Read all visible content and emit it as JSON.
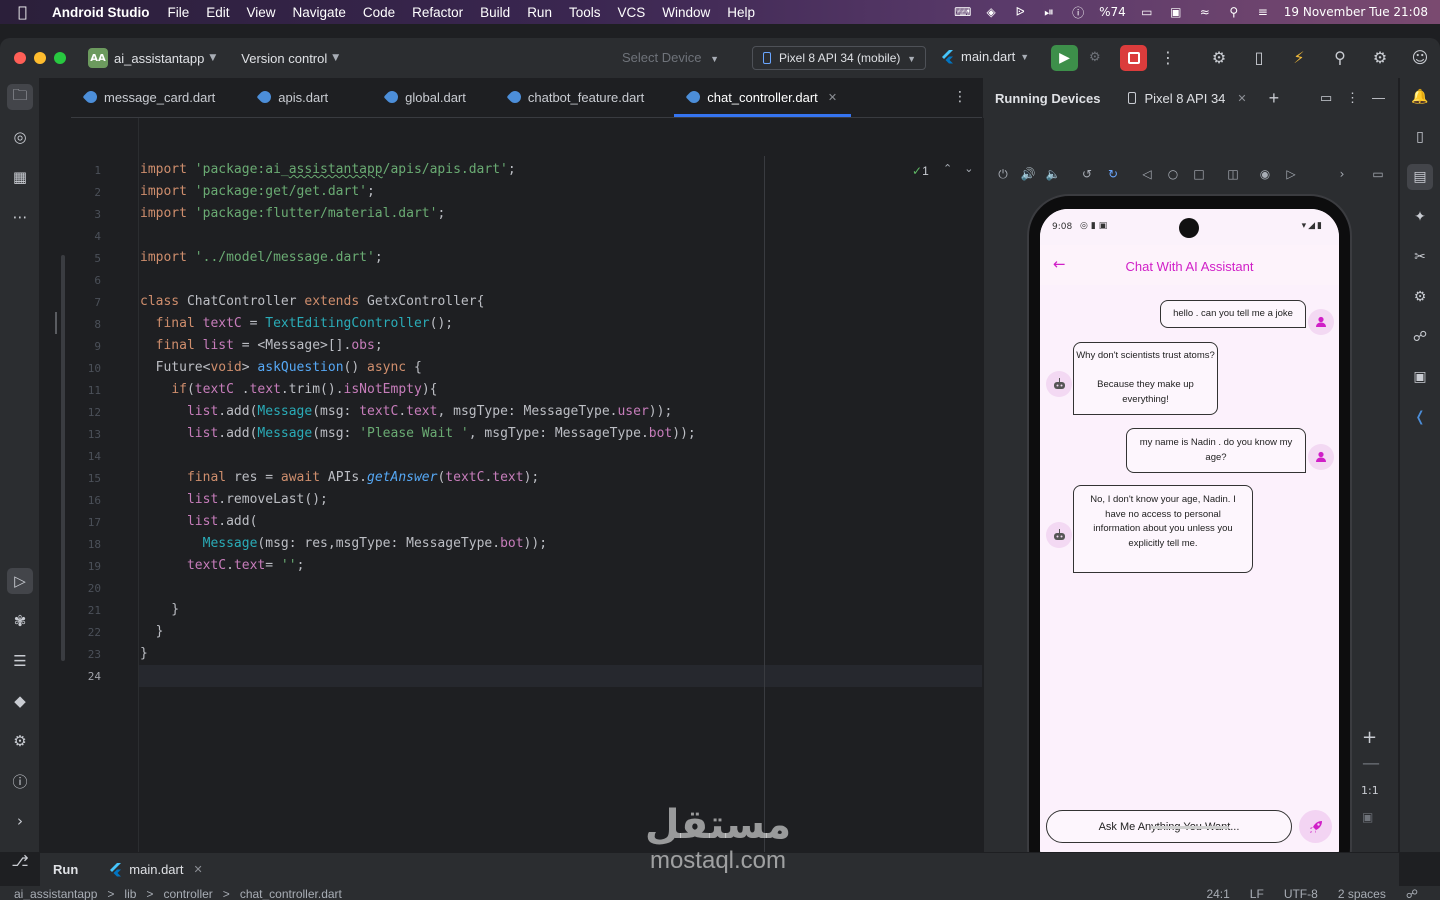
{
  "menubar": {
    "app": "Android Studio",
    "items": [
      "File",
      "Edit",
      "View",
      "Navigate",
      "Code",
      "Refactor",
      "Build",
      "Run",
      "Tools",
      "VCS",
      "Window",
      "Help"
    ],
    "battery": "%74",
    "datetime": "19 November Tue  21:08"
  },
  "titlebar": {
    "project_badge": "AA",
    "project": "ai_assistantapp",
    "version_control": "Version control",
    "select_device": "Select Device",
    "device": "Pixel 8 API 34 (mobile)",
    "config": "main.dart"
  },
  "editor": {
    "tabs": [
      {
        "label": "message_card.dart",
        "active": false
      },
      {
        "label": "apis.dart",
        "active": false
      },
      {
        "label": "global.dart",
        "active": false
      },
      {
        "label": "chatbot_feature.dart",
        "active": false
      },
      {
        "label": "chat_controller.dart",
        "active": true
      }
    ],
    "inspection_count": "1",
    "current_line": 24,
    "lines": [
      [
        [
          "kw",
          "import "
        ],
        [
          "str",
          "'package:ai_"
        ],
        [
          "str squig",
          "assistantapp"
        ],
        [
          "str",
          "/apis/apis.dart'"
        ],
        [
          "",
          "; "
        ]
      ],
      [
        [
          "kw",
          "import "
        ],
        [
          "str",
          "'package:get/get.dart'"
        ],
        [
          "",
          ";"
        ]
      ],
      [
        [
          "kw",
          "import "
        ],
        [
          "str",
          "'package:flutter/material.dart'"
        ],
        [
          "",
          ";"
        ]
      ],
      [],
      [
        [
          "kw",
          "import "
        ],
        [
          "str",
          "'../model/message.dart'"
        ],
        [
          "",
          ";"
        ]
      ],
      [],
      [
        [
          "kw",
          "class "
        ],
        [
          "",
          "ChatController "
        ],
        [
          "kw",
          "extends "
        ],
        [
          "",
          "GetxController{"
        ]
      ],
      [
        [
          "",
          "  "
        ],
        [
          "kw",
          "final "
        ],
        [
          "fld",
          "textC"
        ],
        [
          "",
          " = "
        ],
        [
          "cls",
          "TextEditingController"
        ],
        [
          "",
          "();"
        ]
      ],
      [
        [
          "",
          "  "
        ],
        [
          "kw",
          "final "
        ],
        [
          "fld",
          "list"
        ],
        [
          "",
          " = <Message>[]."
        ],
        [
          "fld",
          "obs"
        ],
        [
          "",
          ";"
        ]
      ],
      [
        [
          "",
          "  Future<"
        ],
        [
          "kw",
          "void"
        ],
        [
          "",
          "> "
        ],
        [
          "fn",
          "askQuestion"
        ],
        [
          "",
          "() "
        ],
        [
          "kw",
          "async"
        ],
        [
          "",
          " {"
        ]
      ],
      [
        [
          "",
          "    "
        ],
        [
          "kw",
          "if"
        ],
        [
          "",
          "("
        ],
        [
          "fld",
          "textC"
        ],
        [
          "",
          " ."
        ],
        [
          "fld",
          "text"
        ],
        [
          "",
          ".trim()."
        ],
        [
          "fld",
          "isNotEmpty"
        ],
        [
          "",
          "){"
        ]
      ],
      [
        [
          "",
          "      "
        ],
        [
          "fld",
          "list"
        ],
        [
          "",
          ".add("
        ],
        [
          "cls",
          "Message"
        ],
        [
          "",
          "(msg: "
        ],
        [
          "fld",
          "textC"
        ],
        [
          "",
          "."
        ],
        [
          "fld",
          "text"
        ],
        [
          "",
          ", msgType: MessageType."
        ],
        [
          "fld",
          "user"
        ],
        [
          "",
          "));"
        ]
      ],
      [
        [
          "",
          "      "
        ],
        [
          "fld",
          "list"
        ],
        [
          "",
          ".add("
        ],
        [
          "cls",
          "Message"
        ],
        [
          "",
          "(msg: "
        ],
        [
          "str",
          "'Please Wait '"
        ],
        [
          "",
          ", msgType: MessageType."
        ],
        [
          "fld",
          "bot"
        ],
        [
          "",
          "));"
        ]
      ],
      [],
      [
        [
          "",
          "      "
        ],
        [
          "kw",
          "final "
        ],
        [
          "",
          "res = "
        ],
        [
          "kw",
          "await "
        ],
        [
          "",
          "APIs."
        ],
        [
          "fn it",
          "getAnswer"
        ],
        [
          "",
          "("
        ],
        [
          "fld",
          "textC"
        ],
        [
          "",
          "."
        ],
        [
          "fld",
          "text"
        ],
        [
          "",
          ");"
        ]
      ],
      [
        [
          "",
          "      "
        ],
        [
          "fld",
          "list"
        ],
        [
          "",
          ".removeLast();"
        ]
      ],
      [
        [
          "",
          "      "
        ],
        [
          "fld",
          "list"
        ],
        [
          "",
          ".add("
        ]
      ],
      [
        [
          "",
          "        "
        ],
        [
          "cls",
          "Message"
        ],
        [
          "",
          "(msg: res,msgType: MessageType."
        ],
        [
          "fld",
          "bot"
        ],
        [
          "",
          "));"
        ]
      ],
      [
        [
          "",
          "      "
        ],
        [
          "fld",
          "textC"
        ],
        [
          "",
          "."
        ],
        [
          "fld",
          "text"
        ],
        [
          "",
          "= "
        ],
        [
          "str",
          "''"
        ],
        [
          "",
          ";"
        ]
      ],
      [],
      [
        [
          "",
          "    }"
        ]
      ],
      [
        [
          "",
          "  }"
        ]
      ],
      [
        [
          "",
          "}"
        ]
      ],
      []
    ]
  },
  "running_devices": {
    "title": "Running Devices",
    "tab": "Pixel 8 API 34",
    "zoom_label": "1:1"
  },
  "phone": {
    "time": "9:08",
    "app_title": "Chat With AI Assistant",
    "messages": [
      {
        "from": "user",
        "text": "hello . can you tell me a joke"
      },
      {
        "from": "bot",
        "text": "Why don't scientists trust atoms?\n\nBecause they make up everything!"
      },
      {
        "from": "user",
        "text": "my name is Nadin . do you know my age?"
      },
      {
        "from": "bot",
        "text": "No, I don't know your age, Nadin.  I have no access to personal information about you unless you explicitly tell me."
      }
    ],
    "input_placeholder": "Ask Me Anything You Want..."
  },
  "bottom": {
    "run": "Run",
    "run_tab": "main.dart"
  },
  "statusbar": {
    "breadcrumbs": [
      "ai_assistantapp",
      ">",
      "lib",
      ">",
      "controller",
      ">",
      "chat_controller.dart"
    ],
    "position": "24:1",
    "line_sep": "LF",
    "encoding": "UTF-8",
    "indent": "2 spaces"
  },
  "watermark": {
    "arabic": "مستقل",
    "latin": "mostaql.com"
  },
  "colors": {
    "accent": "#3574f0",
    "app_pink": "#d01fc7",
    "run_green": "#3d8f4a",
    "stop_red": "#db3c3c"
  }
}
